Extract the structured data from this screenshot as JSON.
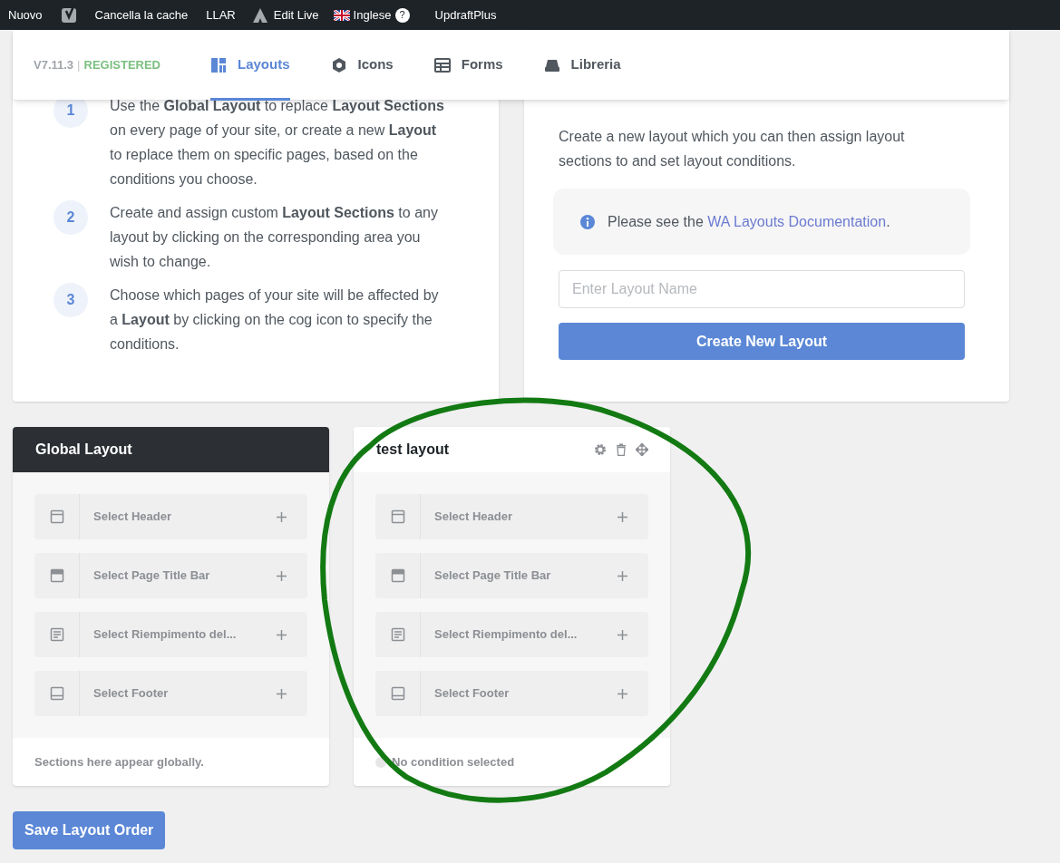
{
  "admin_bar": {
    "items": [
      {
        "kind": "text",
        "label": "Nuovo"
      },
      {
        "kind": "yoast"
      },
      {
        "kind": "text",
        "label": "Cancella la cache"
      },
      {
        "kind": "text",
        "label": "LLAR"
      },
      {
        "kind": "edit",
        "label": "Edit Live"
      },
      {
        "kind": "language",
        "label": "Inglese",
        "badge": "?"
      },
      {
        "kind": "text",
        "label": "UpdraftPlus"
      }
    ]
  },
  "header": {
    "version": "V7.11.3",
    "separator": "|",
    "status": "REGISTERED",
    "tabs": [
      {
        "label": "Layouts",
        "selected": true
      },
      {
        "label": "Icons",
        "selected": false
      },
      {
        "label": "Forms",
        "selected": false
      },
      {
        "label": "Libreria",
        "selected": false
      }
    ]
  },
  "steps": [
    {
      "number": "1",
      "text": "Use the **Global Layout** to replace **Layout Sections** on every page of your site, or create a new **Layout** to replace them on specific pages, based on the conditions you choose."
    },
    {
      "number": "2",
      "text": "Create and assign custom **Layout Sections** to any layout by clicking on the corresponding area you wish to change."
    },
    {
      "number": "3",
      "text": "Choose which pages of your site will be affected by a **Layout** by clicking on the cog icon to specify the conditions."
    }
  ],
  "builder": {
    "description": "Create a new layout which you can then assign layout sections to and set layout conditions.",
    "info": {
      "before": "Please see the ",
      "link": "WA Layouts Documentation",
      "after": "."
    },
    "input": {
      "placeholder": "Enter Layout Name"
    },
    "button": "Create New Layout"
  },
  "layouts": [
    {
      "kind": "global",
      "title": "Global Layout",
      "sections": [
        {
          "kind": "header",
          "label": "Select Header"
        },
        {
          "kind": "titlebar",
          "label": "Select Page Title Bar"
        },
        {
          "kind": "content",
          "label": "Select Riempimento del..."
        },
        {
          "kind": "footer",
          "label": "Select Footer"
        }
      ],
      "footer": "Sections here appear globally."
    },
    {
      "kind": "custom",
      "title": "test layout",
      "sections": [
        {
          "kind": "header",
          "label": "Select Header"
        },
        {
          "kind": "titlebar",
          "label": "Select Page Title Bar"
        },
        {
          "kind": "content",
          "label": "Select Riempimento del..."
        },
        {
          "kind": "footer",
          "label": "Select Footer"
        }
      ],
      "footer": "No condition selected"
    }
  ],
  "save_button": "Save Layout Order"
}
